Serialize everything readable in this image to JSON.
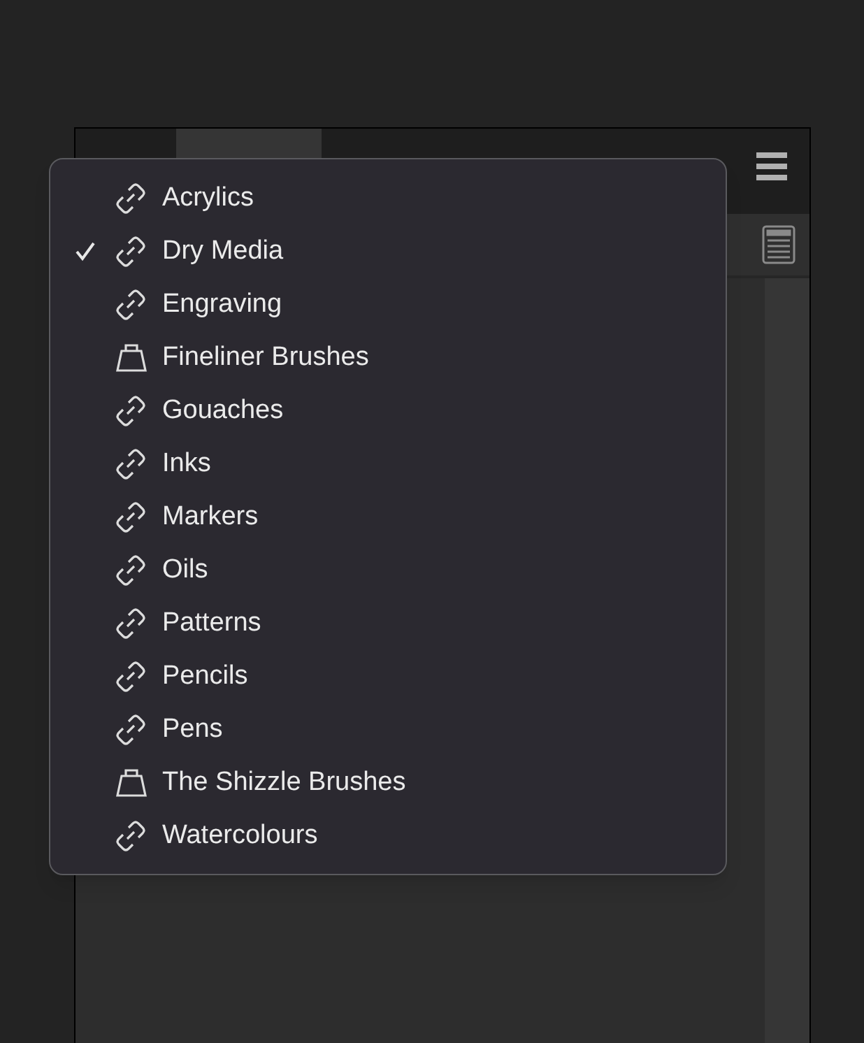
{
  "menu": {
    "items": [
      {
        "label": "Acrylics",
        "kind": "linked",
        "selected": false
      },
      {
        "label": "Dry Media",
        "kind": "linked",
        "selected": true
      },
      {
        "label": "Engraving",
        "kind": "linked",
        "selected": false
      },
      {
        "label": "Fineliner Brushes",
        "kind": "local",
        "selected": false
      },
      {
        "label": "Gouaches",
        "kind": "linked",
        "selected": false
      },
      {
        "label": "Inks",
        "kind": "linked",
        "selected": false
      },
      {
        "label": "Markers",
        "kind": "linked",
        "selected": false
      },
      {
        "label": "Oils",
        "kind": "linked",
        "selected": false
      },
      {
        "label": "Patterns",
        "kind": "linked",
        "selected": false
      },
      {
        "label": "Pencils",
        "kind": "linked",
        "selected": false
      },
      {
        "label": "Pens",
        "kind": "linked",
        "selected": false
      },
      {
        "label": "The Shizzle Brushes",
        "kind": "local",
        "selected": false
      },
      {
        "label": "Watercolours",
        "kind": "linked",
        "selected": false
      }
    ]
  }
}
